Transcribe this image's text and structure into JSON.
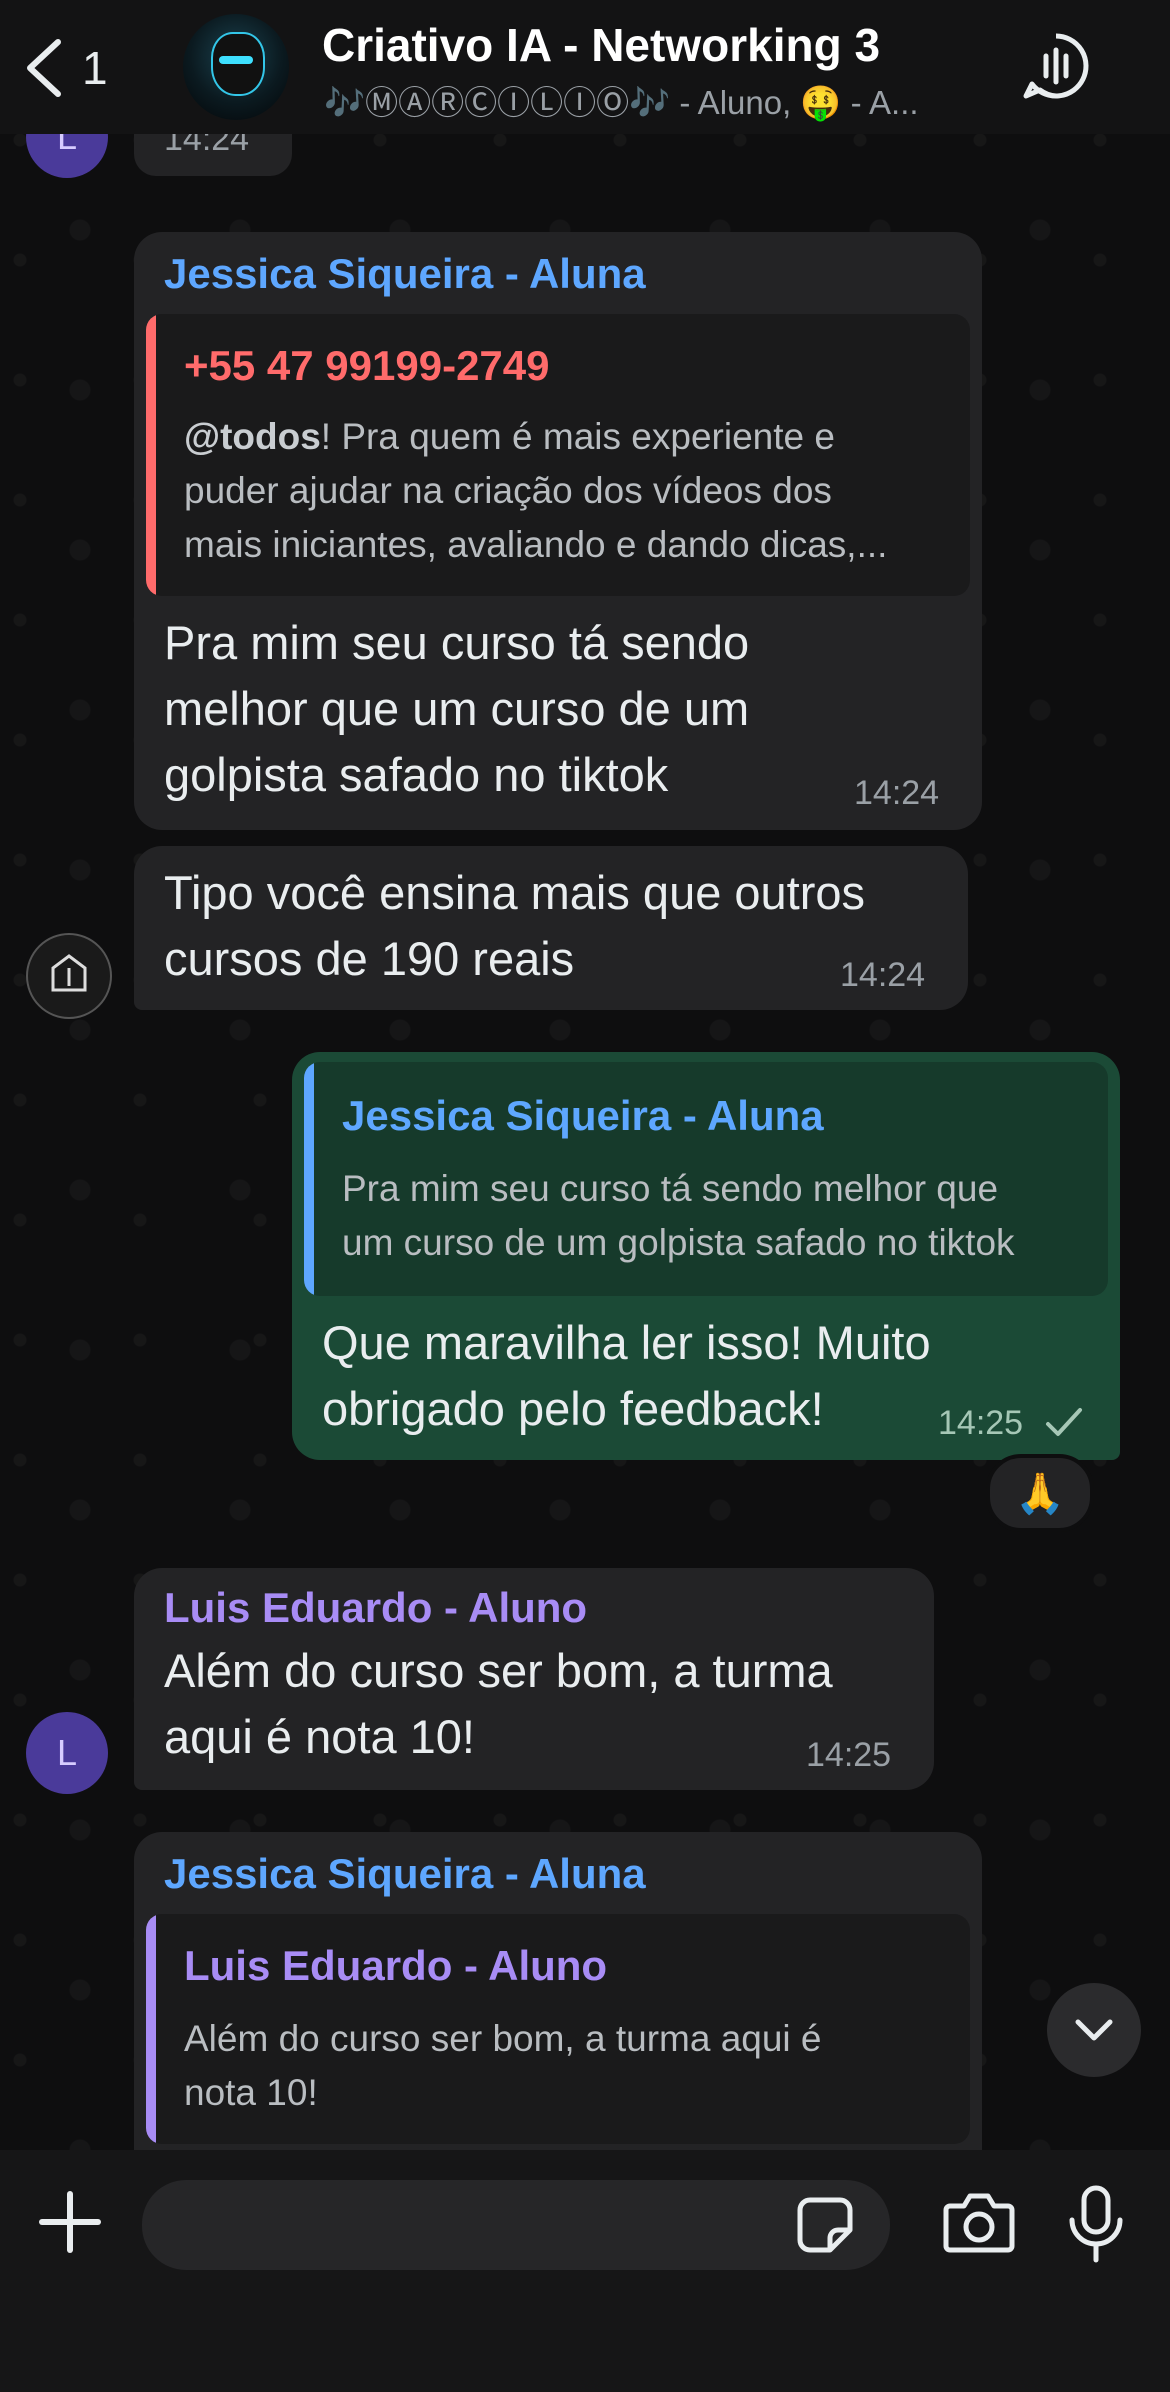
{
  "header": {
    "back_count": "1",
    "title": "Criativo IA - Networking 3",
    "subtitle": "🎶ⓂⒶⓇⒸⒾⓁⒾⓄ🎶 - Aluno, 🤑 - A..."
  },
  "messages": [
    {
      "time": "14:24",
      "avatar_letter": "L"
    },
    {
      "sender": "Jessica Siqueira - Aluna",
      "quote_name": "+55 47 99199-2749",
      "quote_text_line1_mention": "@todos",
      "quote_text_line1_rest": "! Pra quem é mais experiente e",
      "quote_text_line2": "puder ajudar na criação dos vídeos dos",
      "quote_text_line3": "mais iniciantes, avaliando e dando dicas,...",
      "text_line1": "Pra mim seu curso tá sendo",
      "text_line2": "melhor que um curso de um",
      "text_line3": "golpista safado no tiktok",
      "time": "14:24"
    },
    {
      "text_line1": "Tipo você ensina mais que outros",
      "text_line2": "cursos de 190 reais",
      "time": "14:24"
    },
    {
      "quote_name": "Jessica Siqueira - Aluna",
      "quote_text_line1": "Pra mim seu curso tá sendo melhor que",
      "quote_text_line2": "um curso de um golpista safado no tiktok",
      "text_line1": "Que maravilha ler isso! Muito",
      "text_line2": "obrigado pelo feedback!",
      "time": "14:25",
      "reaction": "🙏"
    },
    {
      "sender": "Luis Eduardo - Aluno",
      "text_line1": "Além do curso ser bom, a turma",
      "text_line2": "aqui é nota 10!",
      "time": "14:25",
      "avatar_letter": "L"
    },
    {
      "sender": "Jessica Siqueira - Aluna",
      "quote_name": "Luis Eduardo - Aluno",
      "quote_text_line1": "Além do curso ser bom, a turma aqui é",
      "quote_text_line2": "nota 10!"
    }
  ],
  "colors": {
    "out_bubble": "#1b4a36",
    "in_bubble": "#232325",
    "name_blue": "#5ea7ff",
    "name_purple": "#a88cf5",
    "name_red": "#ff6b6b"
  },
  "icons": [
    "back-chevron-icon",
    "group-avatar",
    "voice-chat-icon",
    "chevron-down-icon",
    "plus-icon",
    "sticker-icon",
    "camera-icon",
    "microphone-icon",
    "read-check-icon"
  ]
}
